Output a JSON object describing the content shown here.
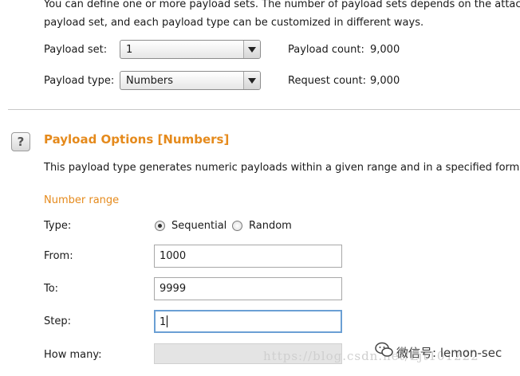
{
  "intro": {
    "line1": "You can define one or more payload sets. The number of payload sets depends on the attack t",
    "line2": "payload set, and each payload type can be customized in different ways."
  },
  "payload_sets": {
    "set_label": "Payload set:",
    "set_value": "1",
    "type_label": "Payload type:",
    "type_value": "Numbers",
    "payload_count_label": "Payload count:",
    "payload_count": "9,000",
    "request_count_label": "Request count:",
    "request_count": "9,000"
  },
  "options": {
    "help_glyph": "?",
    "title": "Payload Options [Numbers]",
    "description": "This payload type generates numeric payloads within a given range and in a specified format.",
    "number_range_heading": "Number range",
    "type_label": "Type:",
    "radio_sequential": "Sequential",
    "radio_random": "Random",
    "selected_type": "Sequential",
    "from_label": "From:",
    "from_value": "1000",
    "to_label": "To:",
    "to_value": "9999",
    "step_label": "Step:",
    "step_value": "1",
    "how_many_label": "How many:",
    "how_many_value": ""
  },
  "watermark": {
    "url": "https://blog.csdn.net/Ljt101222",
    "text": "微信号: lemon-sec"
  },
  "colors": {
    "accent_orange": "#e58a1c",
    "focus_blue": "#6a9fd4"
  }
}
